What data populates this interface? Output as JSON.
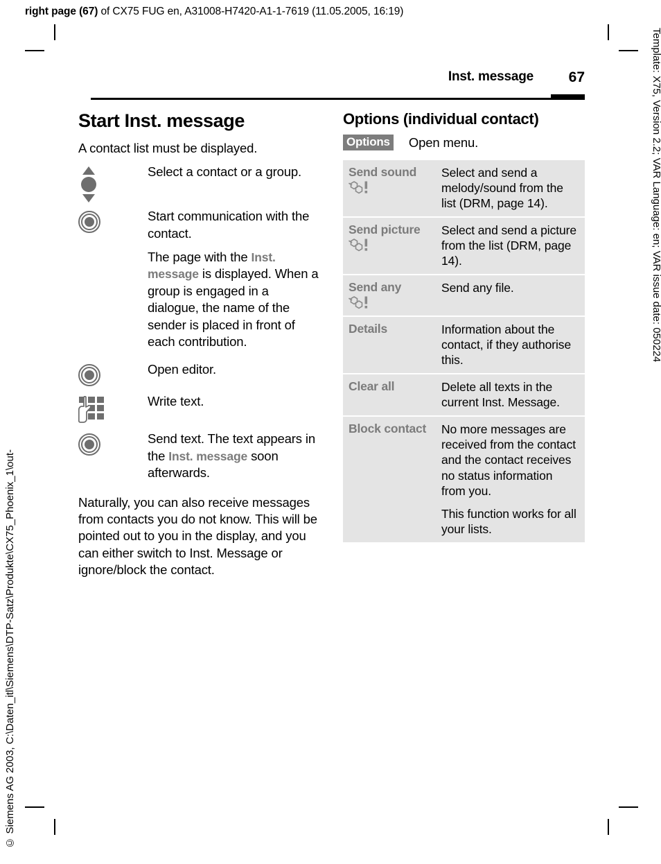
{
  "job_line": {
    "bold_prefix": "right page (67)",
    "rest": " of CX75 FUG en, A31008-H7420-A1-1-7619 (11.05.2005, 16:19)"
  },
  "slugs": {
    "right": "Template: X75, Version 2.2; VAR Language: en; VAR issue date: 050224",
    "left": "© Siemens AG 2003, C:\\Daten_itl\\Siemens\\DTP-Satz\\Produkte\\CX75_Phoenix_1\\out-"
  },
  "header": {
    "title": "Inst. message",
    "page_number": "67"
  },
  "left_column": {
    "heading": "Start Inst. message",
    "intro": "A contact list must be displayed.",
    "steps": [
      {
        "icon": "nav-key-icon",
        "text": "Select a contact or a group."
      },
      {
        "icon": "select-key-icon",
        "text": "Start communication with the contact."
      },
      {
        "icon": "none",
        "text_pre": "The page with the ",
        "display_text": "Inst. message",
        "text_post": " is displayed. When a group is engaged in a dialogue, the name of the sender is placed in front of each contribution."
      },
      {
        "icon": "select-key-icon",
        "text": "Open editor."
      },
      {
        "icon": "keypad-icon",
        "text": "Write text."
      },
      {
        "icon": "select-key-icon",
        "text_pre": "Send text. The text appears in the ",
        "display_text": "Inst. message",
        "text_post": " soon afterwards."
      }
    ],
    "closing_paragraph": "Naturally, you can also receive messages from contacts you do not know. This will be pointed out to you in the display, and you can either switch to Inst. Message or ignore/block the contact."
  },
  "right_column": {
    "heading": "Options (individual contact)",
    "softkey": {
      "label": "Options",
      "description": "Open menu."
    },
    "table_rows": [
      {
        "term": "Send sound",
        "term_icon": "drm-icon",
        "term_icon_position": "below",
        "definition": [
          "Select and send a melody/sound from the list (DRM, page 14)."
        ]
      },
      {
        "term": "Send picture",
        "term_icon": "drm-icon",
        "term_icon_position": "inline",
        "definition": [
          "Select and send a picture from the list (DRM, page 14)."
        ]
      },
      {
        "term": "Send any",
        "term_icon": "drm-icon",
        "term_icon_position": "below",
        "definition": [
          "Send any file."
        ]
      },
      {
        "term": "Details",
        "term_icon": "none",
        "definition": [
          "Information about the contact, if they authorise this."
        ]
      },
      {
        "term": "Clear all",
        "term_icon": "none",
        "definition": [
          "Delete all texts in the current Inst. Message."
        ]
      },
      {
        "term": "Block contact",
        "term_icon": "none",
        "definition": [
          "No more messages are received from the contact and the contact receives no status information from you.",
          "This function works for all your lists."
        ]
      }
    ]
  },
  "colors": {
    "display_text": "#7b7b7b",
    "table_bg": "#e4e4e4",
    "softkey_bg": "#7d7d7d",
    "icon_gray": "#6e6e6e"
  }
}
